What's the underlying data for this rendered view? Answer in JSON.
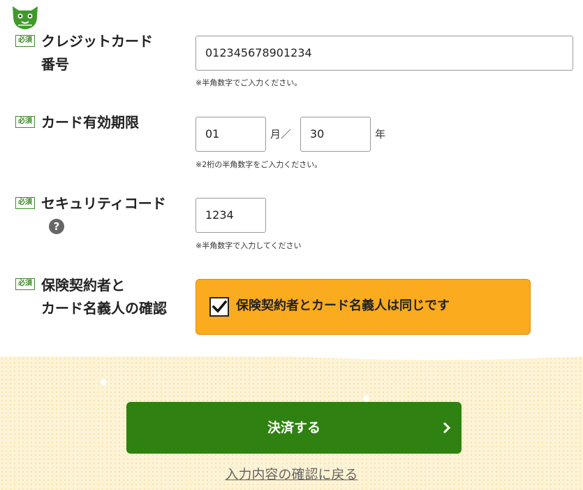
{
  "form": {
    "required_label": "必須",
    "card_number": {
      "label_line1": "クレジットカード",
      "label_line2": "番号",
      "value": "012345678901234",
      "note": "※半角数字でご入力ください。"
    },
    "expiry": {
      "label": "カード有効期限",
      "month": "01",
      "month_unit": "月／",
      "year": "30",
      "year_unit": "年",
      "note": "※2桁の半角数字をご入力ください。"
    },
    "security_code": {
      "label": "セキュリティコード",
      "help": "?",
      "value": "1234",
      "note": "※半角数字で入力してください"
    },
    "holder": {
      "label_line1": "保険契約者と",
      "label_line2": "カード名義人の確認",
      "checkbox_label": "保険契約者とカード名義人は同じです",
      "checked": true
    }
  },
  "actions": {
    "pay_label": "決済する",
    "back_label": "入力内容の確認に戻る"
  },
  "colors": {
    "accent_green": "#2f8211",
    "confirm_orange": "#fbab1e",
    "background_cream": "#fdf3d6"
  }
}
